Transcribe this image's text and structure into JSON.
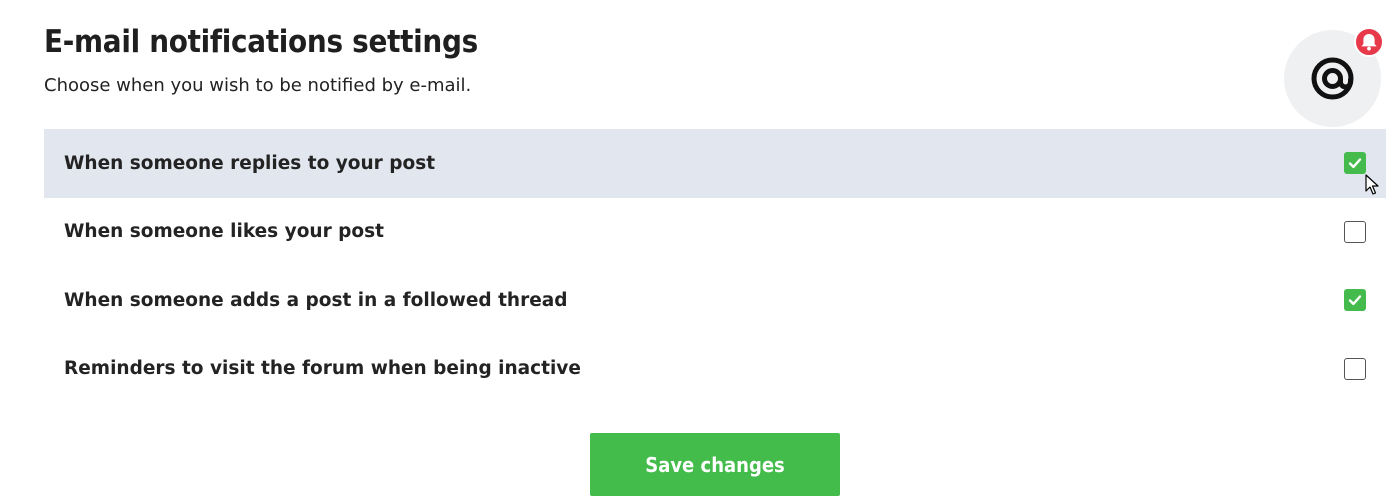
{
  "header": {
    "title": "E-mail notifications settings",
    "subtitle": "Choose when you wish to be notified by e-mail."
  },
  "badge": {
    "icon": "at-sign-icon",
    "notification_icon": "bell-icon",
    "notification_color": "#e8394a"
  },
  "options": [
    {
      "label": "When someone replies to your post",
      "checked": true
    },
    {
      "label": "When someone likes your post",
      "checked": false
    },
    {
      "label": "When someone adds a post in a followed thread",
      "checked": true
    },
    {
      "label": "Reminders to visit the forum when being inactive",
      "checked": false
    }
  ],
  "actions": {
    "save_label": "Save changes"
  },
  "colors": {
    "accent_green": "#43bc4c",
    "row_highlight": "#e2e7ef"
  }
}
